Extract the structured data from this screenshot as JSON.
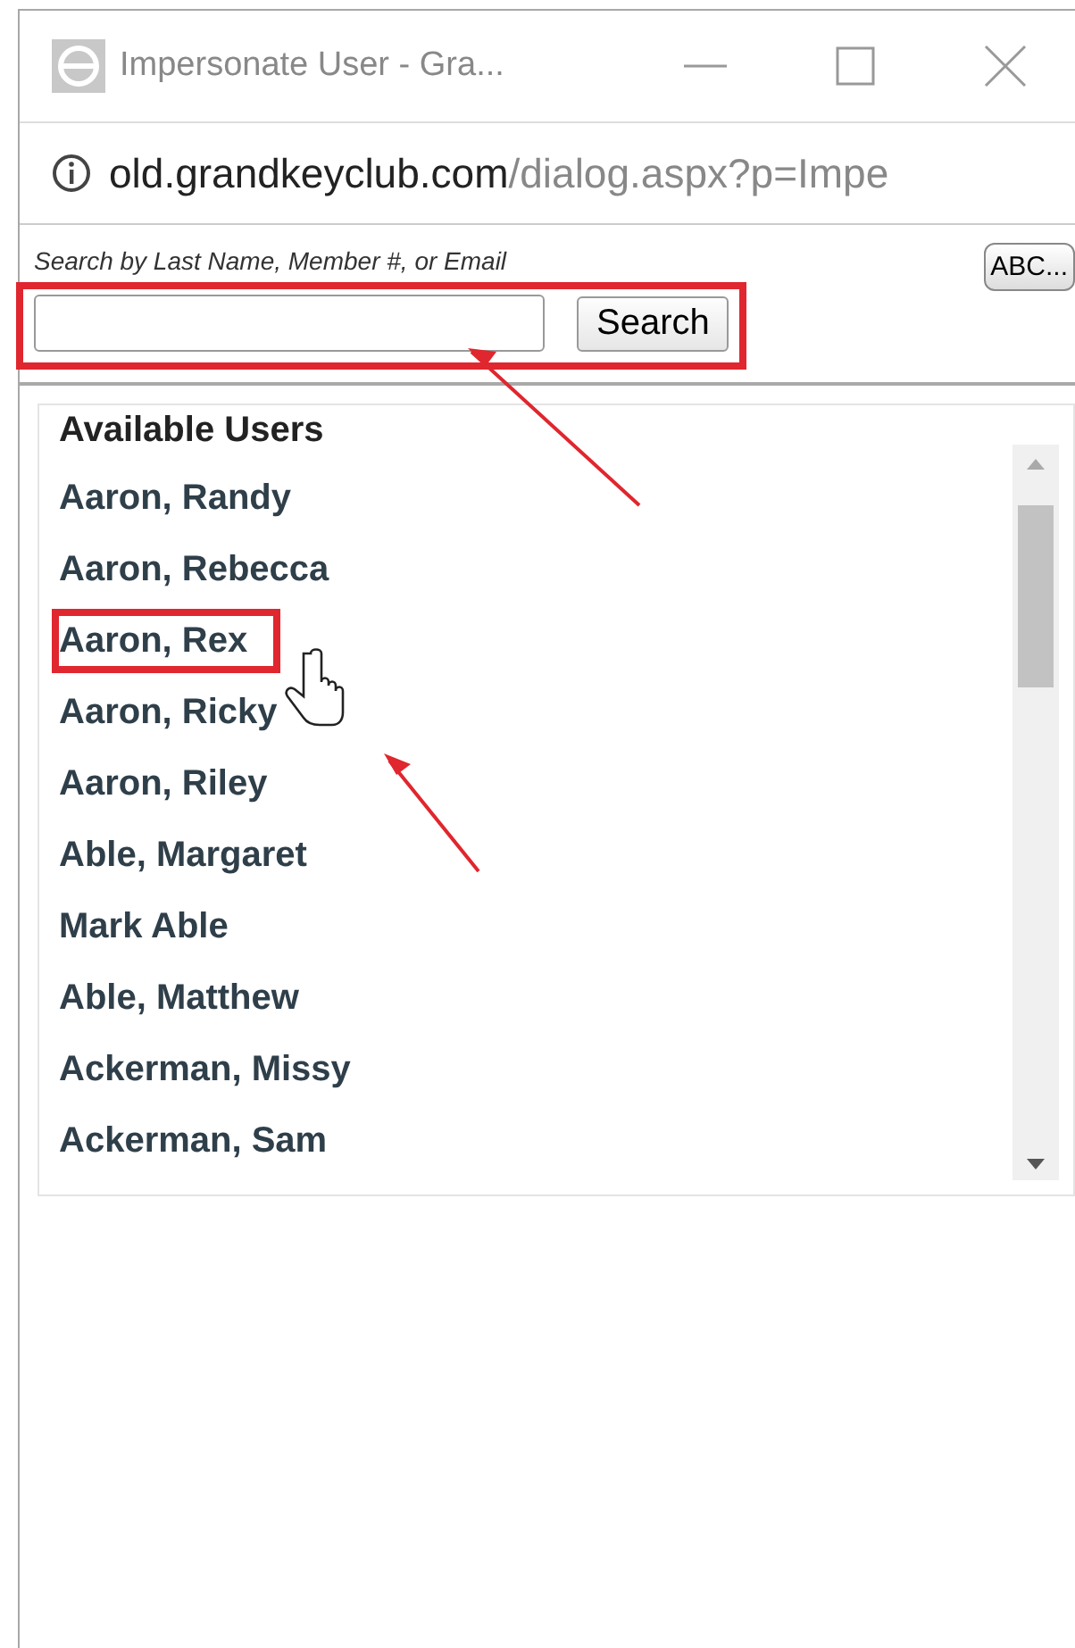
{
  "window": {
    "title": "Impersonate User - Gra..."
  },
  "address_bar": {
    "host": "old.grandkeyclub.com",
    "path": "/dialog.aspx?p=Impe"
  },
  "search": {
    "label": "Search by Last Name, Member #, or Email",
    "abc_button": "ABC...",
    "button": "Search",
    "highlighted": true
  },
  "list": {
    "header": "Available Users",
    "items": [
      {
        "name": "Aaron, Randy",
        "highlighted": false
      },
      {
        "name": "Aaron, Rebecca",
        "highlighted": false
      },
      {
        "name": "Aaron, Rex",
        "highlighted": true
      },
      {
        "name": "Aaron, Ricky",
        "highlighted": false
      },
      {
        "name": "Aaron, Riley",
        "highlighted": false
      },
      {
        "name": "Able, Margaret",
        "highlighted": false
      },
      {
        "name": "Mark Able",
        "highlighted": false
      },
      {
        "name": "Able, Matthew",
        "highlighted": false
      },
      {
        "name": "Ackerman, Missy",
        "highlighted": false
      },
      {
        "name": "Ackerman, Sam",
        "highlighted": false
      }
    ]
  }
}
